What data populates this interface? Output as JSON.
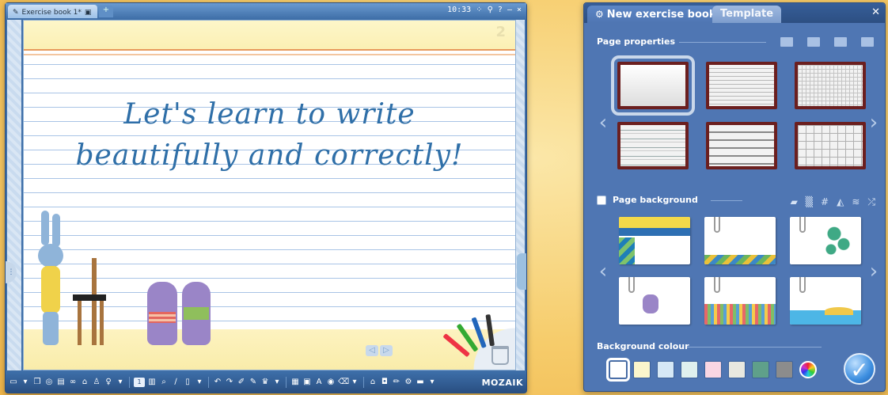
{
  "app": {
    "doc_tab_label": "Exercise book 1*",
    "doc_tab_icon": "pencil-icon",
    "clock": "10:33",
    "window_controls": [
      "grid-icon",
      "search-icon",
      "help-icon",
      "minimize-icon",
      "close-icon"
    ],
    "page_number": "2"
  },
  "canvas": {
    "heading_line1": "Let's learn to write",
    "heading_line2": "beautifully and correctly!",
    "nav_prev": "◁",
    "nav_next": "▷"
  },
  "toolbar": {
    "page_indicator": "1",
    "logo": "MOZAIK",
    "icons": [
      "screen-icon",
      "layers-icon",
      "globe-icon",
      "document-icon",
      "glasses-icon",
      "building-icon",
      "person-icon",
      "bulb-icon",
      "page-icon",
      "zoom-icon",
      "pen-icon",
      "rectangle-icon",
      "undo-icon",
      "redo-icon",
      "brush-icon",
      "highlighter-icon",
      "crown-icon",
      "grid-icon",
      "calendar-icon",
      "text-icon",
      "stamp-icon",
      "trash-icon",
      "home-icon",
      "camera-icon",
      "pencil-icon",
      "settings-icon",
      "ruler-icon"
    ]
  },
  "panel": {
    "tab_active": "New exercise book",
    "tab_inactive": "Template",
    "section_page_properties": "Page properties",
    "section_page_background": "Page background",
    "section_background_colour": "Background colour",
    "page_background_checked": false,
    "page_property_thumbs": [
      "blank",
      "lined",
      "fine-grid",
      "dashed-lined",
      "wide-lined",
      "large-grid"
    ],
    "selected_page_property": 0,
    "background_thumbs": [
      "birds-yellow-blue",
      "clip-triangles",
      "green-circles",
      "mouse-laptop",
      "flowers",
      "island-sea"
    ],
    "colours": [
      "#ffffff",
      "#fbf6cc",
      "#d6e8f6",
      "#dff0ee",
      "#f9d6e3",
      "#e8e8e0",
      "#5fa08a",
      "#8c8c8c"
    ],
    "selected_colour": 0
  }
}
